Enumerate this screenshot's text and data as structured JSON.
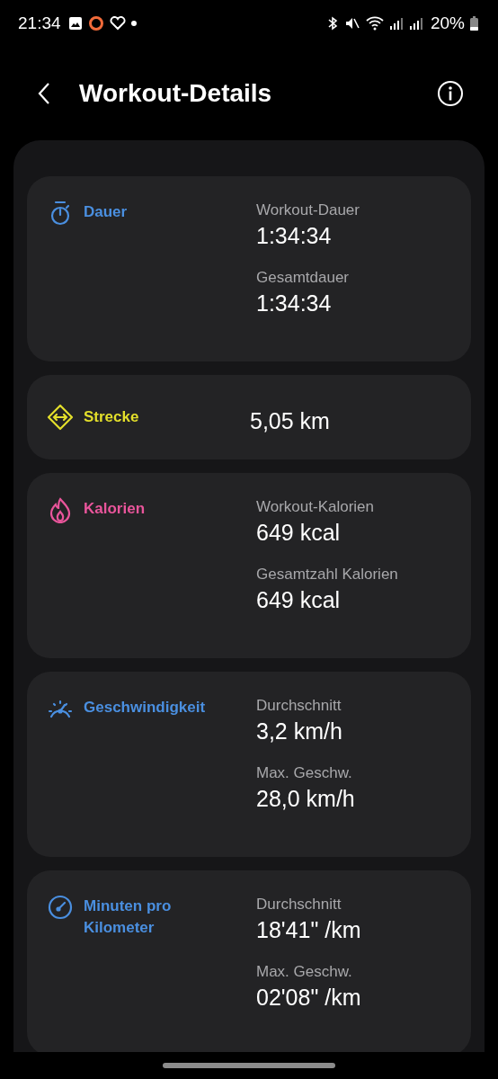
{
  "status_bar": {
    "time": "21:34",
    "battery": "20%"
  },
  "header": {
    "title": "Workout-Details"
  },
  "cards": [
    {
      "kind": "stopwatch",
      "title": "Dauer",
      "color": "#4a8fe0",
      "stats": [
        {
          "label": "Workout-Dauer",
          "value": "1:34:34"
        },
        {
          "label": "Gesamtdauer",
          "value": "1:34:34"
        }
      ]
    },
    {
      "kind": "distance",
      "title": "Strecke",
      "color": "#e3df2b",
      "stats": [
        {
          "value": "5,05 km"
        }
      ]
    },
    {
      "kind": "flame",
      "title": "Kalorien",
      "color": "#e9559b",
      "stats": [
        {
          "label": "Workout-Kalorien",
          "value": "649 kcal"
        },
        {
          "label": "Gesamtzahl Kalorien",
          "value": "649 kcal"
        }
      ]
    },
    {
      "kind": "speedometer",
      "title": "Geschwindigkeit",
      "color": "#4a8fe0",
      "stats": [
        {
          "label": "Durchschnitt",
          "value": "3,2 km/h"
        },
        {
          "label": "Max. Geschw.",
          "value": "28,0 km/h"
        }
      ]
    },
    {
      "kind": "gauge",
      "title": "Minuten pro Kilometer",
      "color": "#4a8fe0",
      "stats": [
        {
          "label": "Durchschnitt",
          "value": "18'41\" /km"
        },
        {
          "label": "Max. Geschw.",
          "value": "02'08\" /km"
        }
      ]
    }
  ]
}
